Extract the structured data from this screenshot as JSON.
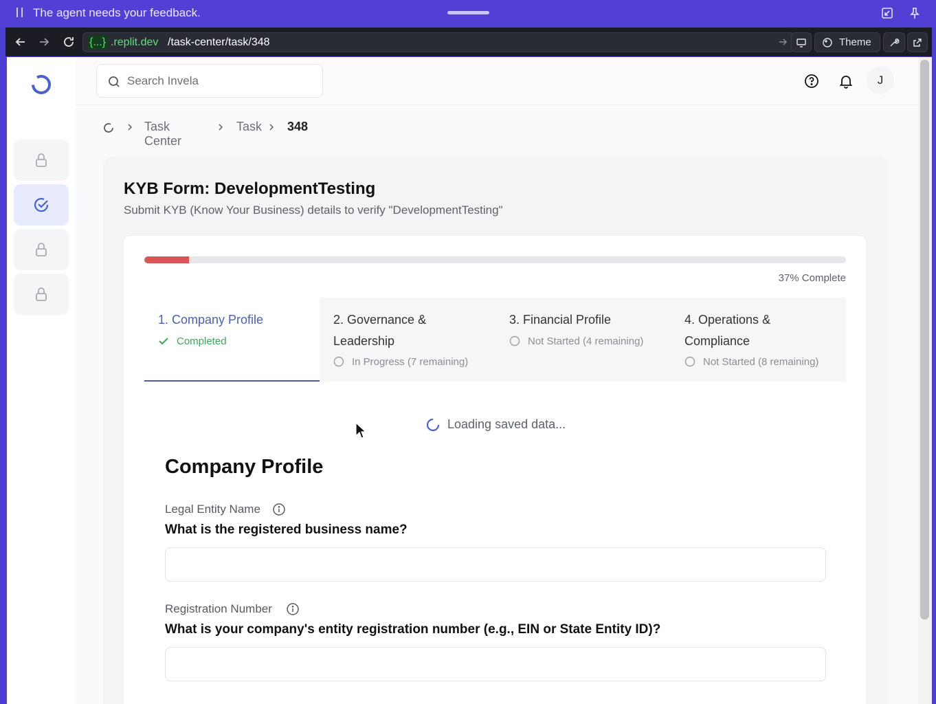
{
  "agent_bar": {
    "message": "The agent needs your feedback."
  },
  "browser": {
    "host_badge": "{...}",
    "host_rest": ".replit.dev",
    "path": "/task-center/task/348",
    "theme_label": "Theme"
  },
  "topbar": {
    "search_placeholder": "Search Invela",
    "avatar_initial": "J"
  },
  "breadcrumb": {
    "items": [
      "Task Center",
      "Task",
      "348"
    ]
  },
  "task": {
    "title": "KYB Form: DevelopmentTesting",
    "subtitle": "Submit KYB (Know Your Business) details to verify \"DevelopmentTesting\"",
    "progress_label": "37% Complete",
    "progress_fraction": 0.064
  },
  "tabs": [
    {
      "label": "1. Company Profile",
      "status": "Completed",
      "state": "completed"
    },
    {
      "label": "2. Governance & Leadership",
      "status": "In Progress (7 remaining)",
      "state": "in-progress"
    },
    {
      "label": "3. Financial Profile",
      "status": "Not Started (4 remaining)",
      "state": "not-started"
    },
    {
      "label": "4. Operations & Compliance",
      "status": "Not Started (8 remaining)",
      "state": "not-started"
    }
  ],
  "loading_text": "Loading saved data...",
  "form": {
    "section_title": "Company Profile",
    "fields": [
      {
        "label": "Legal Entity Name",
        "question": "What is the registered business name?",
        "value": ""
      },
      {
        "label": "Registration Number",
        "question": "What is your company's entity registration number (e.g., EIN or State Entity ID)?",
        "value": ""
      }
    ]
  },
  "colors": {
    "accent": "#4b5fb8",
    "agent_bar": "#5240d6",
    "progress_fill": "#dc5556",
    "success": "#3ba55c"
  }
}
